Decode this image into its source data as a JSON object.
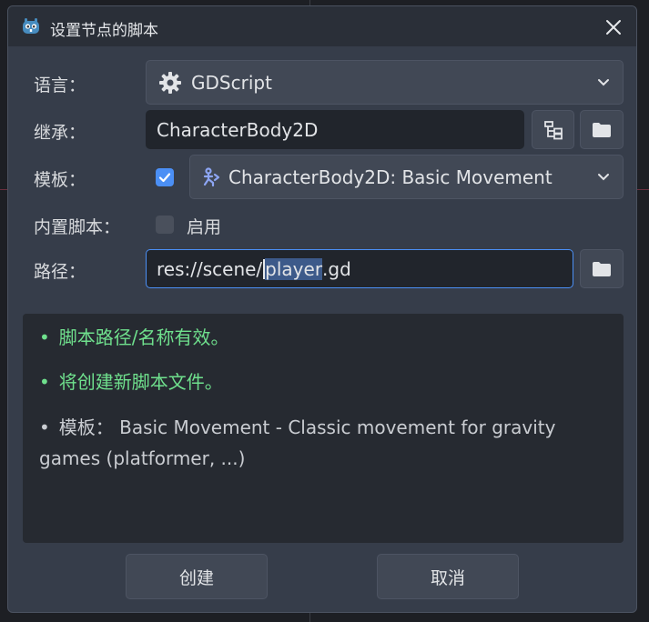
{
  "window": {
    "title": "设置节点的脚本"
  },
  "form": {
    "language": {
      "label": "语言：",
      "value": "GDScript"
    },
    "inherits": {
      "label": "继承：",
      "value": "CharacterBody2D"
    },
    "template": {
      "label": "模板：",
      "checked": true,
      "value": "CharacterBody2D: Basic Movement"
    },
    "builtin": {
      "label": "内置脚本：",
      "checked": false,
      "option_label": "启用"
    },
    "path": {
      "label": "路径：",
      "value_prefix": "res://scene/",
      "value_selected": "player",
      "value_suffix": ".gd"
    }
  },
  "messages": [
    {
      "bullet": "•",
      "text": "脚本路径/名称有效。",
      "status": "valid"
    },
    {
      "bullet": "•",
      "text": "将创建新脚本文件。",
      "status": "valid"
    },
    {
      "bullet": "•",
      "text": "模板： Basic Movement - Classic movement for gravity games (platformer, ...)",
      "status": "info"
    }
  ],
  "buttons": {
    "create": "创建",
    "cancel": "取消"
  },
  "colors": {
    "accent": "#4b8ff5",
    "valid_text": "#6fe08d",
    "panel": "#363d4a",
    "field": "#21252c"
  }
}
